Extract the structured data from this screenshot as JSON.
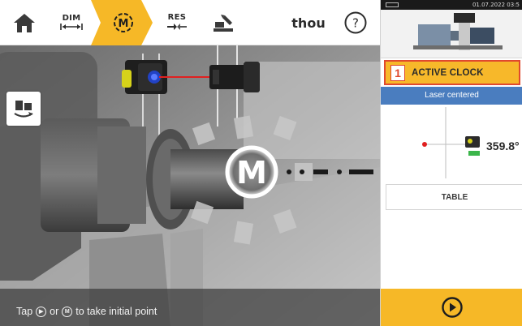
{
  "toolbar": {
    "home_icon": "home-icon",
    "dim_label": "DIM",
    "measure_icon": "measure-m-icon",
    "res_label": "RES",
    "machine_icon": "machine-edit-icon",
    "units_label": "thou",
    "help_label": "?"
  },
  "view": {
    "status_text_pre": "Tap",
    "status_text_mid": "or",
    "status_text_post": "to take initial point",
    "status_glyph_play": "▶",
    "status_glyph_m": "M",
    "m_marker": "M"
  },
  "panel": {
    "system_bar": {
      "time": "01.07.2022 03:5"
    },
    "active_clock": {
      "number": "1",
      "label": "ACTIVE CLOCK"
    },
    "laser_status": "Laser centered",
    "angle_value": "359.8°",
    "table_button": "TABLE",
    "play_icon": "play-icon"
  },
  "colors": {
    "accent_yellow": "#f6b827",
    "alert_red": "#e0492e",
    "info_blue": "#4a7dbf"
  }
}
